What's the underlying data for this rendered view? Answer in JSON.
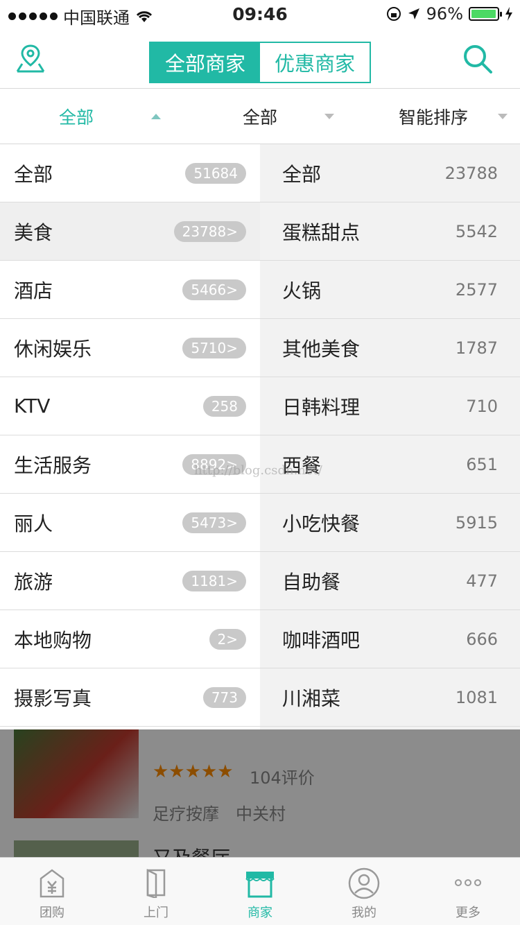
{
  "status": {
    "carrier": "中国联通",
    "time": "09:46",
    "battery": "96%",
    "battery_level": 0.96
  },
  "nav": {
    "seg_all": "全部商家",
    "seg_promo": "优惠商家"
  },
  "filters": [
    {
      "label": "全部"
    },
    {
      "label": "全部"
    },
    {
      "label": "智能排序"
    }
  ],
  "categories": [
    {
      "name": "全部",
      "count": "51684"
    },
    {
      "name": "美食",
      "count": "23788>"
    },
    {
      "name": "酒店",
      "count": "5466>"
    },
    {
      "name": "休闲娱乐",
      "count": "5710>"
    },
    {
      "name": "KTV",
      "count": "258"
    },
    {
      "name": "生活服务",
      "count": "8892>"
    },
    {
      "name": "丽人",
      "count": "5473>"
    },
    {
      "name": "旅游",
      "count": "1181>"
    },
    {
      "name": "本地购物",
      "count": "2>"
    },
    {
      "name": "摄影写真",
      "count": "773"
    }
  ],
  "subcategories": [
    {
      "name": "全部",
      "count": "23788"
    },
    {
      "name": "蛋糕甜点",
      "count": "5542"
    },
    {
      "name": "火锅",
      "count": "2577"
    },
    {
      "name": "其他美食",
      "count": "1787"
    },
    {
      "name": "日韩料理",
      "count": "710"
    },
    {
      "name": "西餐",
      "count": "651"
    },
    {
      "name": "小吃快餐",
      "count": "5915"
    },
    {
      "name": "自助餐",
      "count": "477"
    },
    {
      "name": "咖啡酒吧",
      "count": "666"
    },
    {
      "name": "川湘菜",
      "count": "1081"
    }
  ],
  "bg_list": {
    "item1_reviews": "104评价",
    "item1_tag1": "足疗按摩",
    "item1_tag2": "中关村",
    "item2_title": "又及餐厅"
  },
  "watermark": "http://blog.csdn.net/",
  "tabs": [
    {
      "label": "团购",
      "icon": "group-buy-icon"
    },
    {
      "label": "上门",
      "icon": "door-icon"
    },
    {
      "label": "商家",
      "icon": "store-icon"
    },
    {
      "label": "我的",
      "icon": "user-icon"
    },
    {
      "label": "更多",
      "icon": "more-icon"
    }
  ],
  "colors": {
    "accent": "#21b9a5",
    "star": "#ff8c00"
  }
}
